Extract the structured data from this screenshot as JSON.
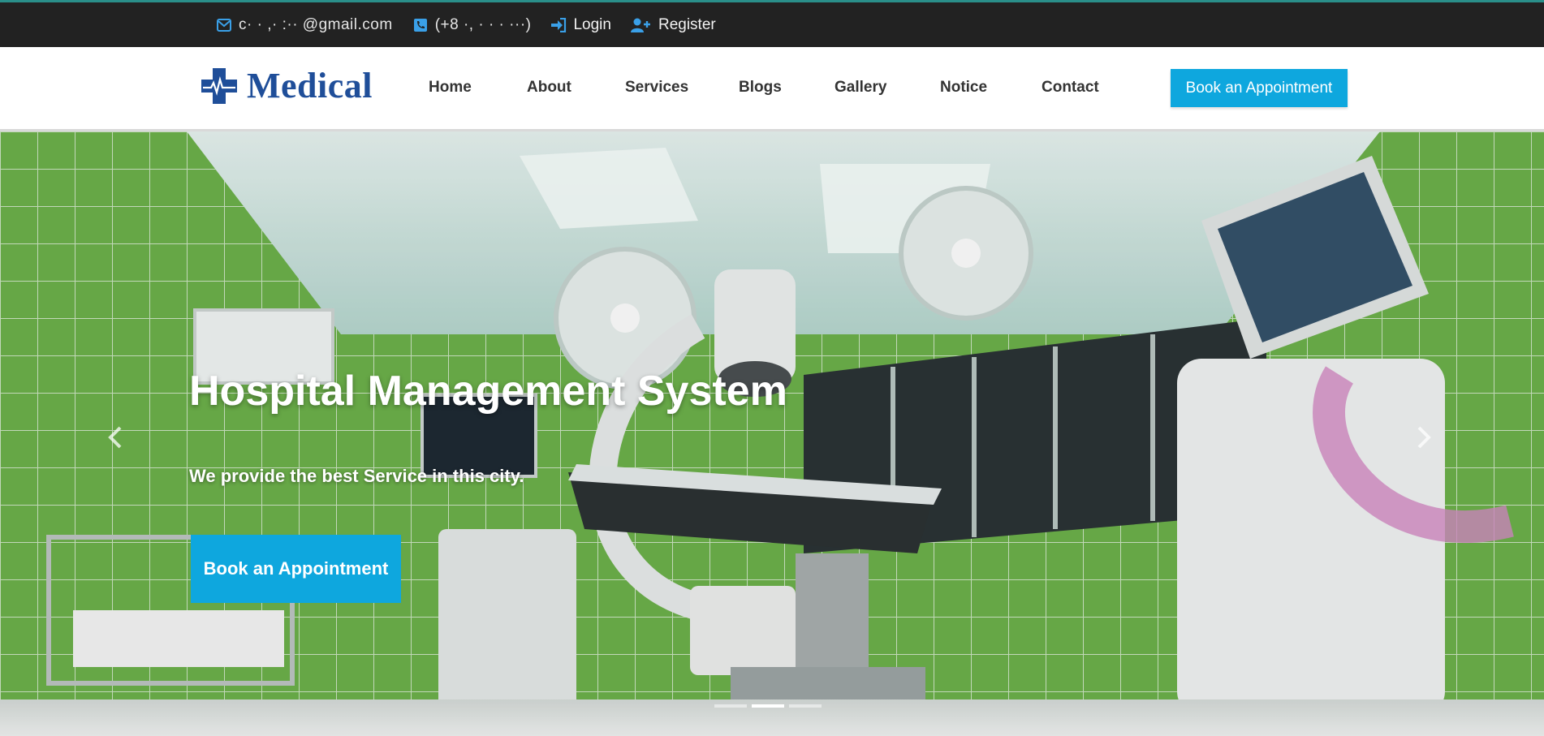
{
  "topbar": {
    "email": "c·  · ,· :·· @gmail.com",
    "phone": "(+8  ·,   · · · ···)",
    "login_label": "Login",
    "register_label": "Register",
    "icons": [
      "envelope-icon",
      "phone-icon",
      "sign-in-icon",
      "user-plus-icon"
    ],
    "accent_color": "#3aa0e8"
  },
  "navbar": {
    "logo_text": "Medical",
    "links": [
      {
        "label": "Home"
      },
      {
        "label": "About"
      },
      {
        "label": "Services"
      },
      {
        "label": "Blogs"
      },
      {
        "label": "Gallery"
      },
      {
        "label": "Notice"
      },
      {
        "label": "Contact"
      }
    ],
    "cta_label": "Book an Appointment",
    "brand_color": "#1f4e99",
    "cta_color": "#0ea7de"
  },
  "hero": {
    "title": "Hospital Management System",
    "subtitle": "We provide the best Service in this city.",
    "cta_label": "Book an Appointment",
    "prev_icon": "chevron-left-icon",
    "next_icon": "chevron-right-icon",
    "slide_count": 3,
    "active_slide": 2
  }
}
